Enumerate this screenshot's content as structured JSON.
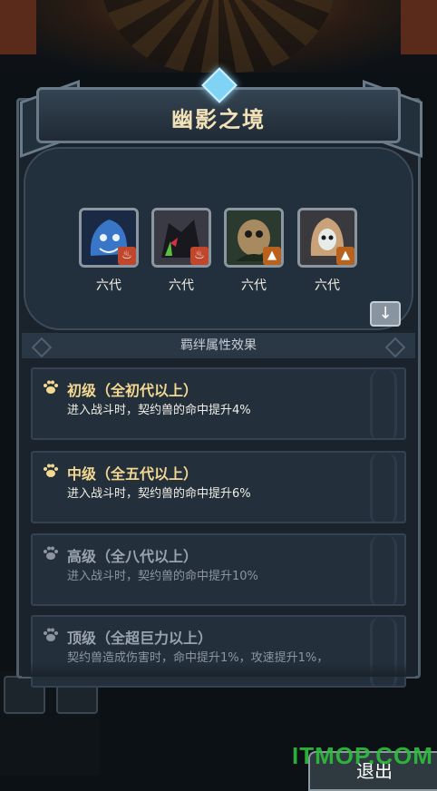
{
  "dialog": {
    "title": "幽影之境"
  },
  "pets": [
    {
      "name": "blue-flame-beast",
      "element": "fire",
      "generation_label": "六代",
      "portrait_color": "#3a76c8"
    },
    {
      "name": "dark-dragon",
      "element": "fire",
      "generation_label": "六代",
      "portrait_color": "#2a2a33"
    },
    {
      "name": "owl-beast",
      "element": "earth",
      "generation_label": "六代",
      "portrait_color": "#7a6a4a"
    },
    {
      "name": "armored-mage",
      "element": "earth",
      "generation_label": "六代",
      "portrait_color": "#c9a27a"
    }
  ],
  "section": {
    "title": "羁绊属性效果"
  },
  "bonds": [
    {
      "title": "初级（全初代以上）",
      "desc": "进入战斗时，契约兽的命中提升4%",
      "active": true
    },
    {
      "title": "中级（全五代以上）",
      "desc": "进入战斗时，契约兽的命中提升6%",
      "active": true
    },
    {
      "title": "高级（全八代以上）",
      "desc": "进入战斗时，契约兽的命中提升10%",
      "active": false
    },
    {
      "title": "顶级（全超巨力以上）",
      "desc": "契约兽造成伤害时，命中提升1%，攻速提升1%，",
      "active": false
    }
  ],
  "bottom": {
    "exit_label": "退出",
    "watermark": "ITMOP.COM"
  },
  "colors": {
    "accent_gold": "#f4d890",
    "fire": "#c0462c",
    "earth": "#b8621d"
  }
}
